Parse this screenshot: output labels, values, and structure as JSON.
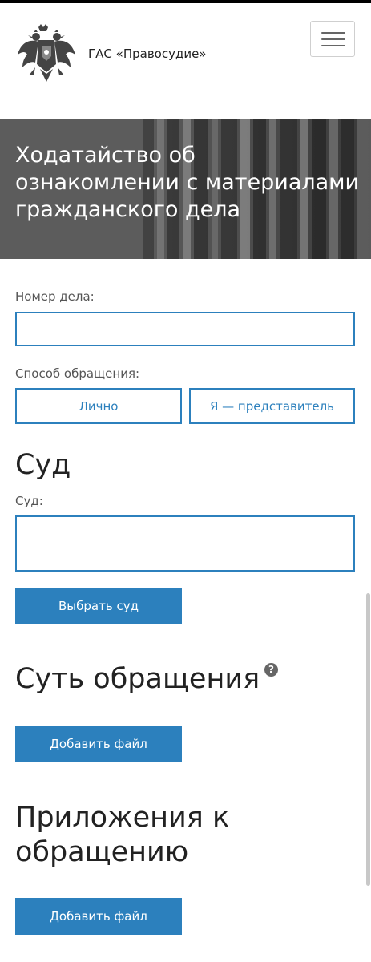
{
  "header": {
    "site_name": "ГАС «Правосудие»"
  },
  "banner": {
    "title": "Ходатайство об ознакомлении с материалами гражданского дела"
  },
  "form": {
    "case_number_label": "Номер дела:",
    "case_number_value": "",
    "method_label": "Способ обращения:",
    "method_options": [
      "Лично",
      "Я — представитель"
    ],
    "court_section_title": "Суд",
    "court_label": "Суд:",
    "court_value": "",
    "select_court_button": "Выбрать суд",
    "essence_title": "Суть обращения",
    "help_icon_glyph": "?",
    "add_file_button_1": "Добавить файл",
    "attachments_title": "Приложения к обращению",
    "add_file_button_2": "Добавить файл"
  },
  "colors": {
    "accent": "#2c80bd",
    "banner_bg": "#5c5c5c"
  }
}
